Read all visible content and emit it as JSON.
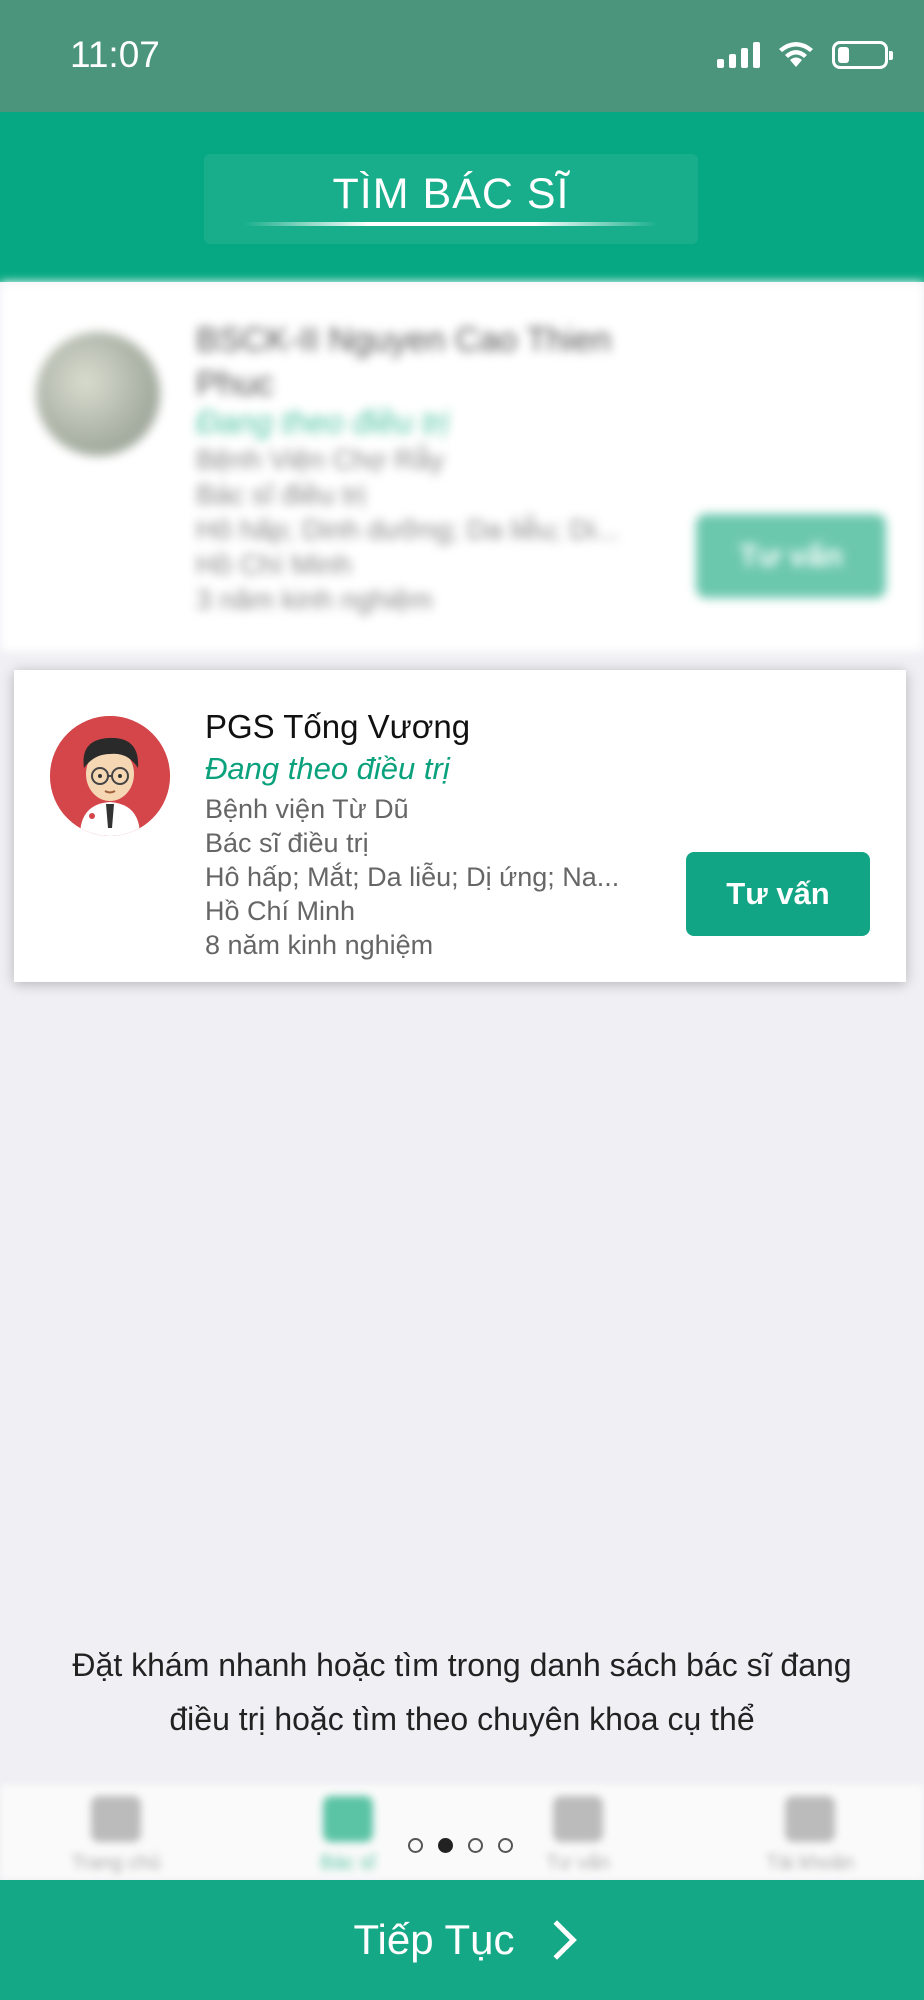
{
  "status_bar": {
    "time": "11:07",
    "icons": [
      "signal-icon",
      "wifi-icon",
      "battery-icon"
    ],
    "battery_level": 0.25
  },
  "header": {
    "title": "TÌM BÁC SĨ"
  },
  "doctors": [
    {
      "name": "BSCK-II Nguyen Cao Thien Phuc",
      "status": "Đang theo điều trị",
      "hospital": "Bệnh Viện Chợ Rẫy",
      "role": "Bác sĩ điều trị",
      "specialties": "Hô hấp; Dinh dưỡng; Da liễu; Di...",
      "city": "Hồ Chí Minh",
      "experience": "3 năm kinh nghiệm",
      "button": "Tư vấn"
    },
    {
      "name": "PGS Tống Vương",
      "status": "Đang theo điều trị",
      "hospital": "Bệnh viện Từ Dũ",
      "role": "Bác sĩ điều trị",
      "specialties": "Hô hấp; Mắt; Da liễu; Dị ứng; Na...",
      "city": "Hồ Chí Minh",
      "experience": "8 năm kinh nghiệm",
      "button": "Tư vấn"
    }
  ],
  "onboarding": {
    "description": "Đặt khám nhanh hoặc tìm trong danh sách bác sĩ đang điều trị hoặc tìm theo chuyên khoa cụ thể",
    "page_count": 4,
    "current_page": 2,
    "continue_label": "Tiếp Tục"
  },
  "tabbar": [
    {
      "label": "Trang chủ",
      "icon": "home-icon"
    },
    {
      "label": "Bác sĩ",
      "icon": "doctor-icon"
    },
    {
      "label": "Tư vấn",
      "icon": "chat-icon"
    },
    {
      "label": "Tài khoản",
      "icon": "account-icon"
    }
  ],
  "colors": {
    "primary": "#05a882",
    "button": "#12a585",
    "status_text": "#0aa17d",
    "background": "#efeff4"
  }
}
